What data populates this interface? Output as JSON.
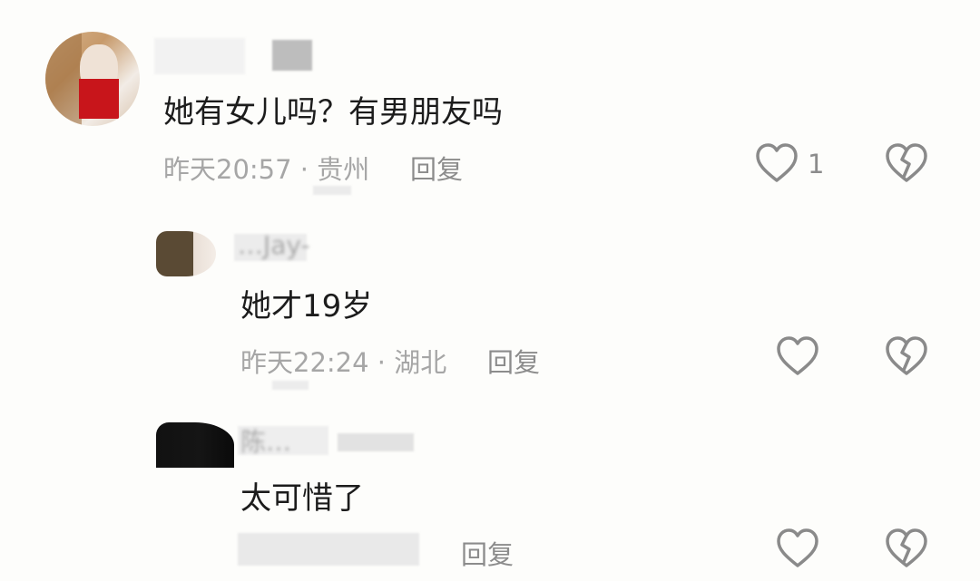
{
  "comments": [
    {
      "username": "",
      "text": "她有女儿吗？有男朋友吗",
      "time": "昨天20:57 · 贵州",
      "reply_label": "回复",
      "like_count": "1"
    },
    {
      "username": "…Jay-",
      "text": "她才19岁",
      "time": "昨天22:24 · 湖北",
      "reply_label": "回复",
      "like_count": ""
    },
    {
      "username": "陈…",
      "text": "太可惜了",
      "time": "",
      "reply_label": "回复",
      "like_count": ""
    }
  ],
  "icons": {
    "like": "heart-outline-icon",
    "dislike": "broken-heart-icon"
  },
  "colors": {
    "background": "#fdfdfb",
    "text": "#1c1c1c",
    "meta": "#a6a6a6",
    "icon": "#8a8a8a"
  }
}
